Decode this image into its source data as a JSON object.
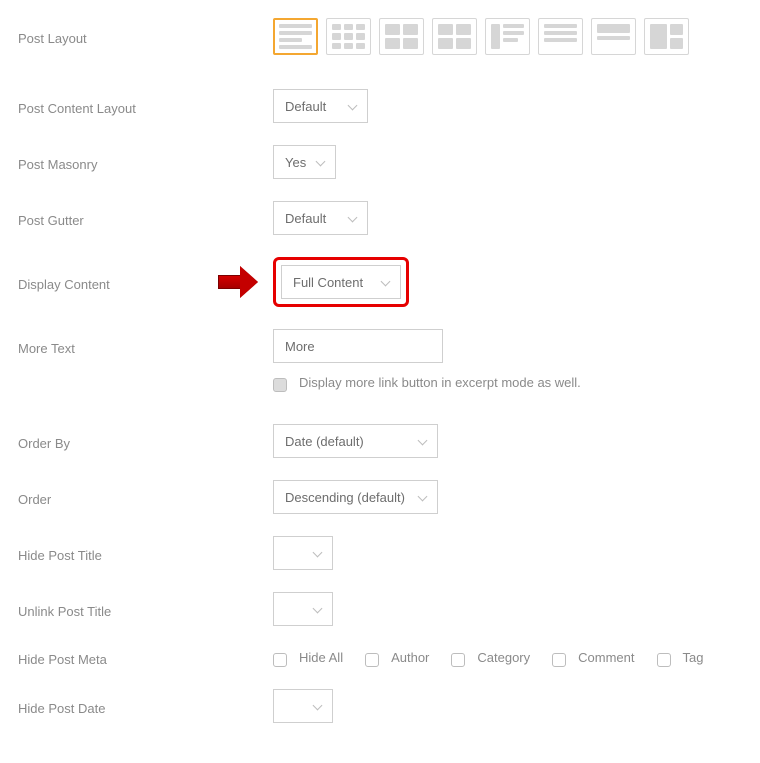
{
  "fields": {
    "post_layout": {
      "label": "Post Layout"
    },
    "post_content_layout": {
      "label": "Post Content Layout",
      "value": "Default"
    },
    "post_masonry": {
      "label": "Post Masonry",
      "value": "Yes"
    },
    "post_gutter": {
      "label": "Post Gutter",
      "value": "Default"
    },
    "display_content": {
      "label": "Display Content",
      "value": "Full Content"
    },
    "more_text": {
      "label": "More Text",
      "value": "More"
    },
    "display_more_note": "Display more link button in excerpt mode as well.",
    "order_by": {
      "label": "Order By",
      "value": "Date (default)"
    },
    "order": {
      "label": "Order",
      "value": "Descending (default)"
    },
    "hide_post_title": {
      "label": "Hide Post Title",
      "value": ""
    },
    "unlink_post_title": {
      "label": "Unlink Post Title",
      "value": ""
    },
    "hide_post_meta": {
      "label": "Hide Post Meta",
      "options": {
        "hide_all": "Hide All",
        "author": "Author",
        "category": "Category",
        "comment": "Comment",
        "tag": "Tag"
      }
    },
    "hide_post_date": {
      "label": "Hide Post Date",
      "value": ""
    }
  }
}
